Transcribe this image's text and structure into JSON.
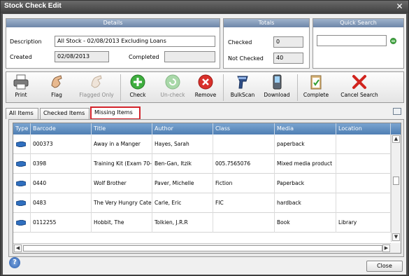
{
  "window": {
    "title": "Stock Check Edit"
  },
  "details": {
    "header": "Details",
    "description_label": "Description",
    "description_value": "All Stock - 02/08/2013 Excluding Loans",
    "created_label": "Created",
    "created_value": "02/08/2013",
    "completed_label": "Completed",
    "completed_value": ""
  },
  "totals": {
    "header": "Totals",
    "checked_label": "Checked",
    "checked_value": "0",
    "not_checked_label": "Not Checked",
    "not_checked_value": "40"
  },
  "quick_search": {
    "header": "Quick Search",
    "value": ""
  },
  "toolbar": {
    "print": "Print",
    "flag": "Flag",
    "flagged_only": "Flagged Only",
    "check": "Check",
    "uncheck": "Un-check",
    "remove": "Remove",
    "bulkscan": "BulkScan",
    "download": "Download",
    "complete": "Complete",
    "cancel_search": "Cancel Search"
  },
  "tabs": {
    "all_items": "All Items",
    "checked_items": "Checked Items",
    "missing_items": "Missing Items"
  },
  "grid": {
    "columns": [
      "Type",
      "Barcode",
      "Title",
      "Author",
      "Class",
      "Media",
      "Location"
    ],
    "rows": [
      [
        "000373",
        "Away in a Manger",
        "Hayes, Sarah",
        "",
        "paperback",
        ""
      ],
      [
        "0398",
        "Training Kit (Exam 70-",
        "Ben-Gan, Itzik",
        "005.7565076",
        "Mixed media product",
        ""
      ],
      [
        "0440",
        "Wolf Brother",
        "Paver, Michelle",
        "Fiction",
        "Paperback",
        ""
      ],
      [
        "0483",
        "The Very Hungry Cate",
        "Carle, Eric",
        "FIC",
        "hardback",
        ""
      ],
      [
        "0112255",
        "Hobbit, The",
        "Tolkien, J.R.R",
        "",
        "Book",
        "Library"
      ]
    ]
  },
  "footer": {
    "help": "?",
    "close": "Close"
  },
  "colors": {
    "accent": "#d3242b",
    "header_blue": "#4f7fb3",
    "check_green": "#3fae3f",
    "remove_red": "#d9302b"
  }
}
